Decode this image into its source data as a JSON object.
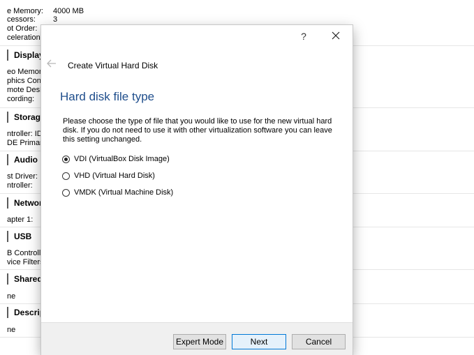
{
  "background": {
    "top_lines": [
      {
        "label": "e Memory:",
        "value": "4000 MB"
      },
      {
        "label": "cessors:",
        "value": "3"
      },
      {
        "label": "ot Order:",
        "value": ""
      },
      {
        "label": "celeration:",
        "value": ""
      }
    ],
    "sections": [
      {
        "title": "Display",
        "lines": [
          "eo Memor",
          "phics Con",
          "mote Desk",
          "cording:"
        ]
      },
      {
        "title": "Storag",
        "lines": [
          "ntroller: ID",
          "DE Primary"
        ]
      },
      {
        "title": "Audio",
        "lines": [
          "st Driver:",
          "ntroller:"
        ]
      },
      {
        "title": "Networ",
        "lines": [
          "apter 1:"
        ]
      },
      {
        "title": "USB",
        "lines": [
          "B Controlle",
          "vice Filters"
        ]
      },
      {
        "title": "Shared",
        "lines": [
          "ne"
        ]
      },
      {
        "title": "Descrip",
        "lines": [
          "ne"
        ]
      }
    ]
  },
  "dialog": {
    "help_label": "?",
    "wizard_title": "Create Virtual Hard Disk",
    "heading": "Hard disk file type",
    "description": "Please choose the type of file that you would like to use for the new virtual hard disk. If you do not need to use it with other virtualization software you can leave this setting unchanged.",
    "options": [
      {
        "label": "VDI (VirtualBox Disk Image)",
        "checked": true
      },
      {
        "label": "VHD (Virtual Hard Disk)",
        "checked": false
      },
      {
        "label": "VMDK (Virtual Machine Disk)",
        "checked": false
      }
    ],
    "buttons": {
      "expert": "Expert Mode",
      "next": "Next",
      "cancel": "Cancel"
    }
  }
}
